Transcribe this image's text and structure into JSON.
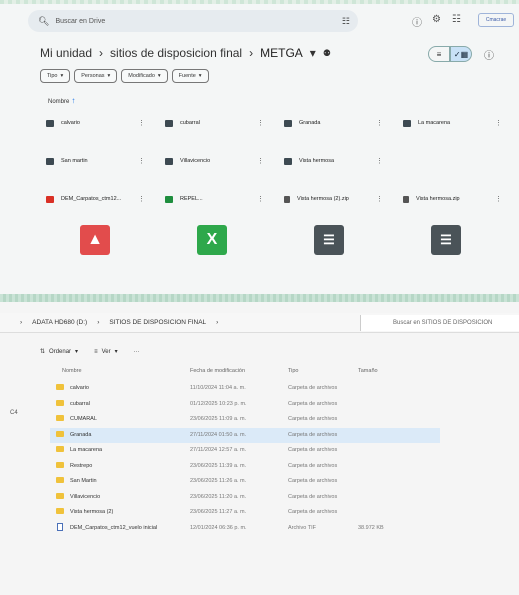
{
  "drive": {
    "search_placeholder": "Buscar en Drive",
    "brand": "Cmacrae",
    "breadcrumb": [
      "Mi unidad",
      "sitios de disposicion final",
      "METGA"
    ],
    "chips": [
      "Tipo",
      "Personas",
      "Modificado",
      "Fuente"
    ],
    "sort_label": "Nombre",
    "folders": [
      "calvario",
      "cubarral",
      "Granada",
      "La macarena",
      "San martin",
      "Villavicencio",
      "Vista hermosa"
    ],
    "files": [
      "DEM_Carpatos_ctm12...",
      "REPEL...",
      "Vista hermosa (2).zip",
      "Vista hermosa.zip"
    ]
  },
  "explorer": {
    "address": [
      "ADATA HD680 (D:)",
      "SITIOS DE DISPOSICION FINAL"
    ],
    "search_placeholder": "Buscar en SITIOS DE DISPOSICION",
    "toolbar": {
      "sort": "Ordenar",
      "view": "Ver",
      "more": "···"
    },
    "columns": {
      "name": "Nombre",
      "date": "Fecha de modificación",
      "type": "Tipo",
      "size": "Tamaño"
    },
    "rows": [
      {
        "name": "calvario",
        "date": "11/10/2024 11:04 a. m.",
        "type": "Carpeta de archivos",
        "size": ""
      },
      {
        "name": "cubarral",
        "date": "01/12/2025 10:23 p. m.",
        "type": "Carpeta de archivos",
        "size": ""
      },
      {
        "name": "CUMARAL",
        "date": "23/06/2025 11:09 a. m.",
        "type": "Carpeta de archivos",
        "size": ""
      },
      {
        "name": "Granada",
        "date": "27/11/2024 01:50 a. m.",
        "type": "Carpeta de archivos",
        "size": ""
      },
      {
        "name": "La macarena",
        "date": "27/11/2024 12:57 a. m.",
        "type": "Carpeta de archivos",
        "size": ""
      },
      {
        "name": "Restrepo",
        "date": "23/06/2025 11:39 a. m.",
        "type": "Carpeta de archivos",
        "size": ""
      },
      {
        "name": "San Martin",
        "date": "23/06/2025 11:26 a. m.",
        "type": "Carpeta de archivos",
        "size": ""
      },
      {
        "name": "Villavicencio",
        "date": "23/06/2025 11:20 a. m.",
        "type": "Carpeta de archivos",
        "size": ""
      },
      {
        "name": "Vista hermosa (2)",
        "date": "23/06/2025 11:27 a. m.",
        "type": "Carpeta de archivos",
        "size": ""
      },
      {
        "name": "DEM_Carpatos_ctm12_vuelo inicial",
        "date": "12/01/2024 06:36 p. m.",
        "type": "Archivo TIF",
        "size": "38.972 KB"
      }
    ],
    "left_label": "C4"
  }
}
